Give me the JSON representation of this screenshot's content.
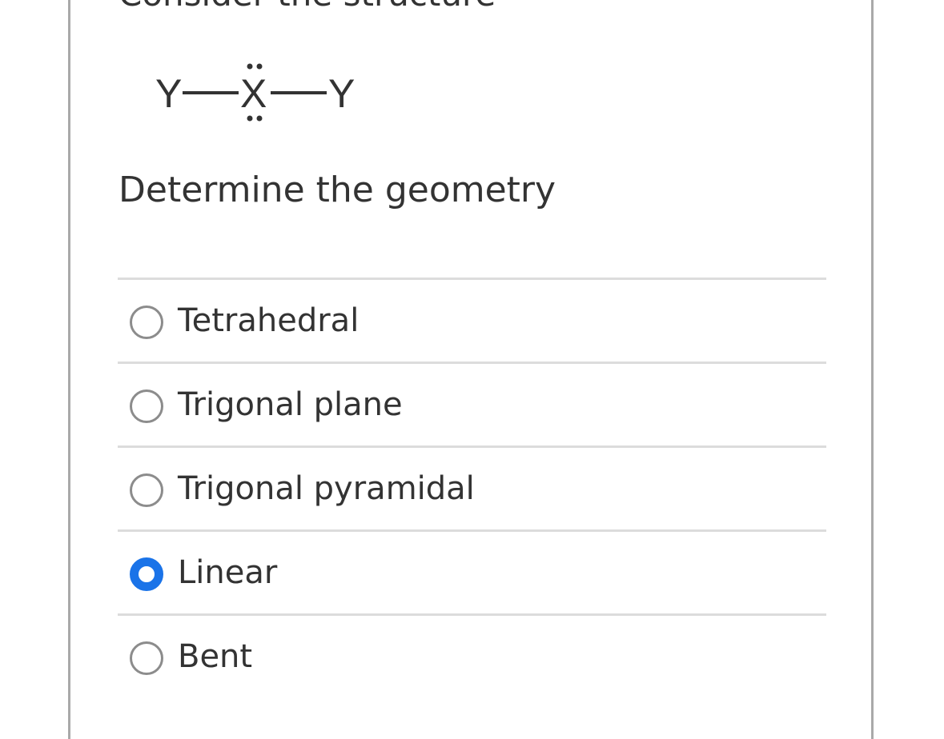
{
  "question": {
    "header": "Consider the structure",
    "structure": {
      "left_atom": "Y",
      "central_atom": "X",
      "right_atom": "Y"
    },
    "prompt": "Determine the geometry"
  },
  "options": [
    {
      "label": "Tetrahedral",
      "selected": false
    },
    {
      "label": "Trigonal plane",
      "selected": false
    },
    {
      "label": "Trigonal pyramidal",
      "selected": false
    },
    {
      "label": "Linear",
      "selected": true
    },
    {
      "label": "Bent",
      "selected": false
    }
  ],
  "colors": {
    "accent": "#1a73e8",
    "text": "#333333",
    "divider": "#dcdcdc",
    "radio_border": "#8c8c8c",
    "card_border": "#a9a9a9"
  }
}
